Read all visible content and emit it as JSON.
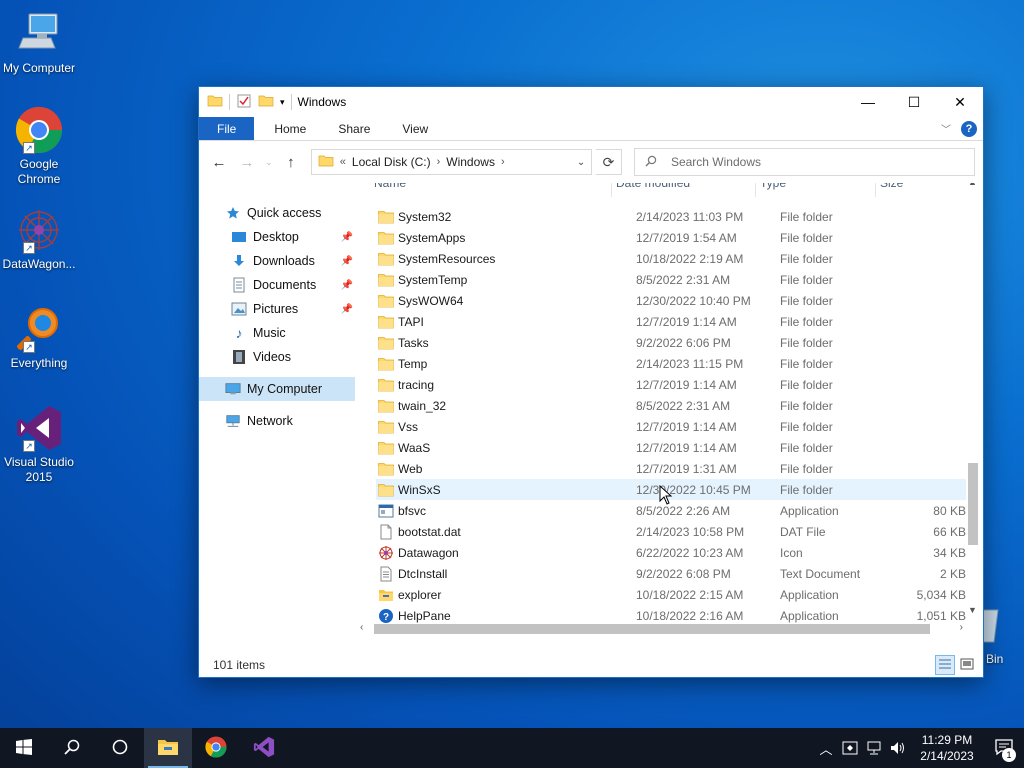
{
  "desktop": {
    "icons": [
      {
        "label": "My Computer"
      },
      {
        "label": "Google Chrome"
      },
      {
        "label": "DataWagon..."
      },
      {
        "label": "Everything"
      },
      {
        "label": "Visual Studio 2015"
      }
    ],
    "recycle_bin_partial_label": "Bin"
  },
  "window": {
    "title": "Windows",
    "controls": {
      "minimize": "—",
      "maximize": "☐",
      "close": "✕"
    },
    "ribbon": {
      "tabs": [
        "File",
        "Home",
        "Share",
        "View"
      ]
    },
    "address": {
      "prefix": "«",
      "segments": [
        "Local Disk (C:)",
        "Windows"
      ]
    },
    "search": {
      "placeholder": "Search Windows"
    },
    "nav": [
      {
        "label": "Quick access",
        "icon": "star-icon"
      },
      {
        "label": "Desktop",
        "icon": "desktop-icon",
        "pinned": true
      },
      {
        "label": "Downloads",
        "icon": "download-icon",
        "pinned": true
      },
      {
        "label": "Documents",
        "icon": "documents-icon",
        "pinned": true
      },
      {
        "label": "Pictures",
        "icon": "pictures-icon",
        "pinned": true
      },
      {
        "label": "Music",
        "icon": "music-icon"
      },
      {
        "label": "Videos",
        "icon": "videos-icon"
      },
      {
        "label": "My Computer",
        "icon": "computer-icon",
        "selected": true
      },
      {
        "label": "Network",
        "icon": "network-icon"
      }
    ],
    "columns": [
      "Name",
      "Date modified",
      "Type",
      "Size"
    ],
    "files": [
      {
        "name": "System32",
        "date": "2/14/2023 11:03 PM",
        "type": "File folder",
        "size": "",
        "icon": "folder-icon"
      },
      {
        "name": "SystemApps",
        "date": "12/7/2019 1:54 AM",
        "type": "File folder",
        "size": "",
        "icon": "folder-icon"
      },
      {
        "name": "SystemResources",
        "date": "10/18/2022 2:19 AM",
        "type": "File folder",
        "size": "",
        "icon": "folder-icon"
      },
      {
        "name": "SystemTemp",
        "date": "8/5/2022 2:31 AM",
        "type": "File folder",
        "size": "",
        "icon": "folder-icon"
      },
      {
        "name": "SysWOW64",
        "date": "12/30/2022 10:40 PM",
        "type": "File folder",
        "size": "",
        "icon": "folder-icon"
      },
      {
        "name": "TAPI",
        "date": "12/7/2019 1:14 AM",
        "type": "File folder",
        "size": "",
        "icon": "folder-icon"
      },
      {
        "name": "Tasks",
        "date": "9/2/2022 6:06 PM",
        "type": "File folder",
        "size": "",
        "icon": "folder-icon"
      },
      {
        "name": "Temp",
        "date": "2/14/2023 11:15 PM",
        "type": "File folder",
        "size": "",
        "icon": "folder-icon"
      },
      {
        "name": "tracing",
        "date": "12/7/2019 1:14 AM",
        "type": "File folder",
        "size": "",
        "icon": "folder-icon"
      },
      {
        "name": "twain_32",
        "date": "8/5/2022 2:31 AM",
        "type": "File folder",
        "size": "",
        "icon": "folder-icon"
      },
      {
        "name": "Vss",
        "date": "12/7/2019 1:14 AM",
        "type": "File folder",
        "size": "",
        "icon": "folder-icon"
      },
      {
        "name": "WaaS",
        "date": "12/7/2019 1:14 AM",
        "type": "File folder",
        "size": "",
        "icon": "folder-icon"
      },
      {
        "name": "Web",
        "date": "12/7/2019 1:31 AM",
        "type": "File folder",
        "size": "",
        "icon": "folder-icon"
      },
      {
        "name": "WinSxS",
        "date": "12/30/2022 10:45 PM",
        "type": "File folder",
        "size": "",
        "icon": "folder-icon",
        "hover": true
      },
      {
        "name": "bfsvc",
        "date": "8/5/2022 2:26 AM",
        "type": "Application",
        "size": "80 KB",
        "icon": "app-icon"
      },
      {
        "name": "bootstat.dat",
        "date": "2/14/2023 10:58 PM",
        "type": "DAT File",
        "size": "66 KB",
        "icon": "file-icon"
      },
      {
        "name": "Datawagon",
        "date": "6/22/2022 10:23 AM",
        "type": "Icon",
        "size": "34 KB",
        "icon": "ico-icon"
      },
      {
        "name": "DtcInstall",
        "date": "9/2/2022 6:08 PM",
        "type": "Text Document",
        "size": "2 KB",
        "icon": "text-icon"
      },
      {
        "name": "explorer",
        "date": "10/18/2022 2:15 AM",
        "type": "Application",
        "size": "5,034 KB",
        "icon": "explorer-icon"
      },
      {
        "name": "HelpPane",
        "date": "10/18/2022 2:16 AM",
        "type": "Application",
        "size": "1,051 KB",
        "icon": "help-icon"
      }
    ],
    "status": {
      "item_count": "101 items"
    }
  },
  "taskbar": {
    "clock_time": "11:29 PM",
    "clock_date": "2/14/2023",
    "notification_count": "1"
  }
}
